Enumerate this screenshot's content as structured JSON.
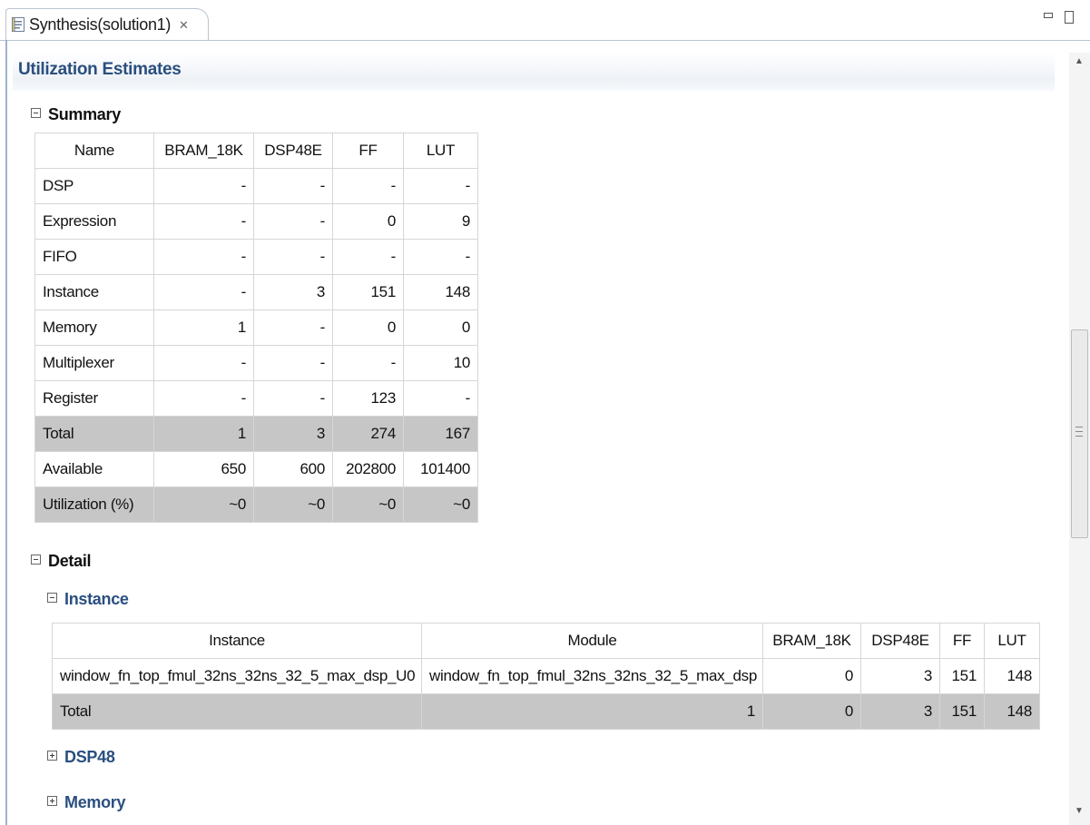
{
  "tab": {
    "title": "Synthesis(solution1)",
    "close_glyph": "✕",
    "icon": "report-icon"
  },
  "window_controls": [
    "minimize-icon",
    "maximize-icon"
  ],
  "page": {
    "title": "Utilization Estimates",
    "summary_heading": "Summary",
    "detail_heading": "Detail",
    "instance_heading": "Instance",
    "dsp48_heading": "DSP48",
    "memory_heading": "Memory"
  },
  "summary": {
    "headers": [
      "Name",
      "BRAM_18K",
      "DSP48E",
      "FF",
      "LUT"
    ],
    "rows": [
      [
        "DSP",
        "-",
        "-",
        "-",
        "-"
      ],
      [
        "Expression",
        "-",
        "-",
        "0",
        "9"
      ],
      [
        "FIFO",
        "-",
        "-",
        "-",
        "-"
      ],
      [
        "Instance",
        "-",
        "3",
        "151",
        "148"
      ],
      [
        "Memory",
        "1",
        "-",
        "0",
        "0"
      ],
      [
        "Multiplexer",
        "-",
        "-",
        "-",
        "10"
      ],
      [
        "Register",
        "-",
        "-",
        "123",
        "-"
      ],
      [
        "Total",
        "1",
        "3",
        "274",
        "167"
      ],
      [
        "Available",
        "650",
        "600",
        "202800",
        "101400"
      ],
      [
        "Utilization (%)",
        "~0",
        "~0",
        "~0",
        "~0"
      ]
    ],
    "gray_rows": [
      7,
      9
    ]
  },
  "instance_table": {
    "headers": [
      "Instance",
      "Module",
      "BRAM_18K",
      "DSP48E",
      "FF",
      "LUT"
    ],
    "rows": [
      [
        "window_fn_top_fmul_32ns_32ns_32_5_max_dsp_U0",
        "window_fn_top_fmul_32ns_32ns_32_5_max_dsp",
        "0",
        "3",
        "151",
        "148"
      ],
      [
        "Total",
        "1",
        "0",
        "3",
        "151",
        "148"
      ]
    ]
  },
  "colors": {
    "heading_blue": "#2a4f7f",
    "total_row_gray": "#c6c6c6"
  }
}
